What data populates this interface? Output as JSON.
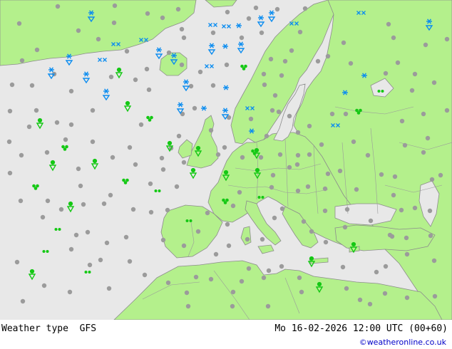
{
  "product": "Weather type",
  "model": "GFS",
  "datetime": "Mo 16-02-2026 12:00 UTC (00+60)",
  "credit": "©weatheronline.co.uk",
  "colors": {
    "sea": "#e8e8e8",
    "land": "#b4f08c",
    "border": "#9a9a9a",
    "coast": "#8c8c8c",
    "snow": "#0a8cf0",
    "rain": "#14c814",
    "dry": "#9b9b9b"
  },
  "legend_symbols": {
    "dry": "grey-dot-icon",
    "rain": "green-raindrop-icon",
    "rain_shower": "green-shower-icon",
    "drizzle": "green-drizzle-icon",
    "snow": "blue-snowflake-icon",
    "snow_shower": "blue-snow-shower-icon"
  }
}
